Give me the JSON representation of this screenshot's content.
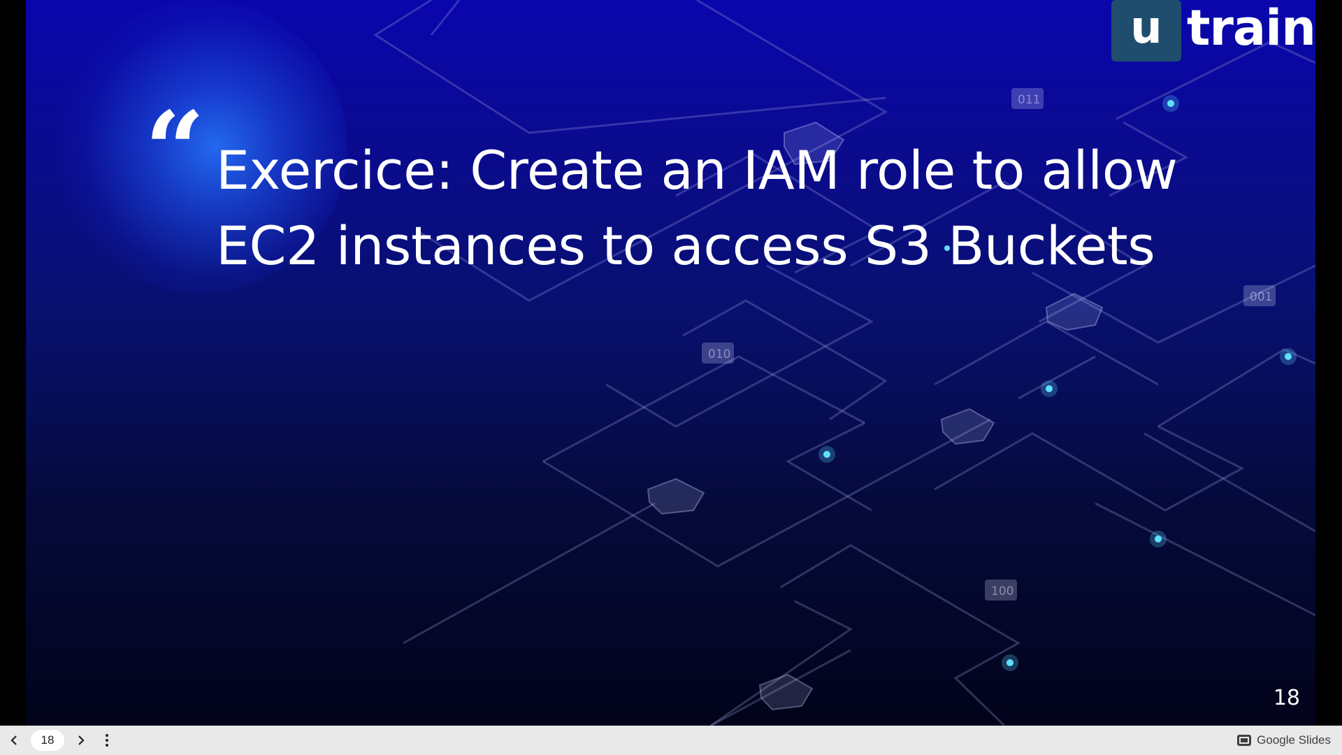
{
  "slide": {
    "logo": {
      "box_letter": "u",
      "text": "train"
    },
    "quote_mark": "“",
    "title": "Exercice: Create an IAM role to allow EC2 instances to access S3 Buckets",
    "slide_number": "18",
    "circuit_tags": [
      "011",
      "001",
      "010",
      "100"
    ]
  },
  "toolbar": {
    "prev_icon": "chevron-left-icon",
    "next_icon": "chevron-right-icon",
    "page_number": "18",
    "more_icon": "more-vert-icon",
    "brand_label": "Google Slides",
    "brand_icon": "slides-icon"
  },
  "colors": {
    "slide_top": "#0a06ad",
    "slide_bottom": "#02031a",
    "logo_box": "#1f4d6e",
    "toolbar_bg": "#e9e9e9"
  }
}
